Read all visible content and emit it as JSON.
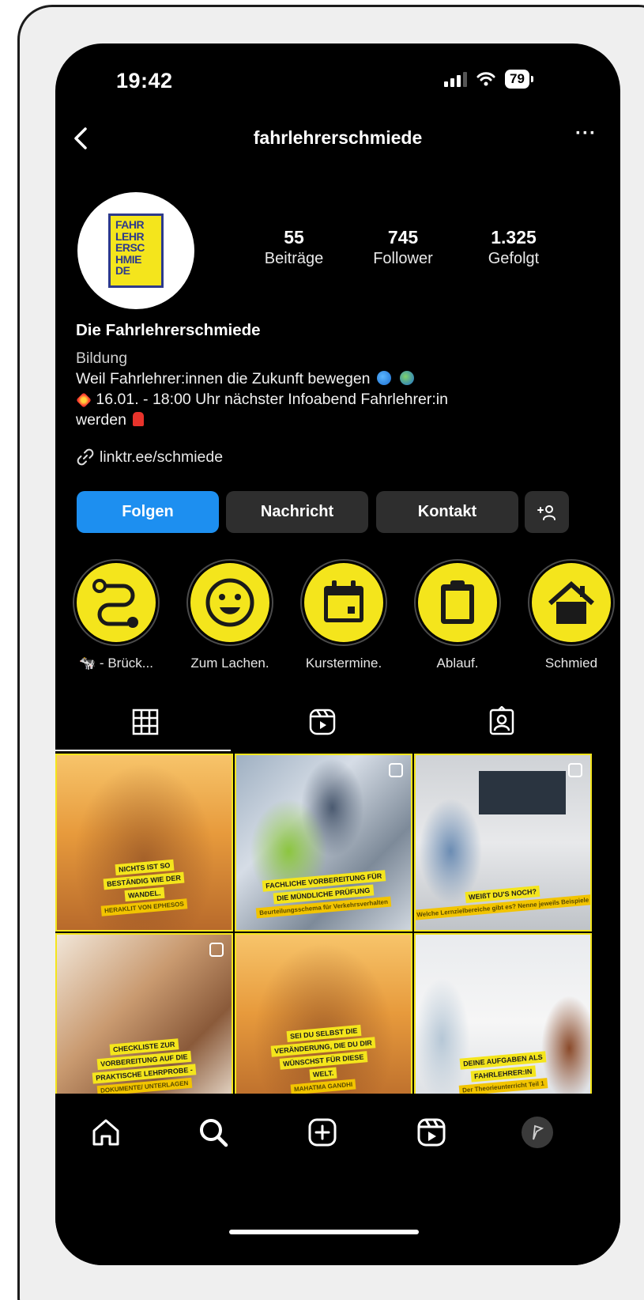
{
  "status_bar": {
    "time": "19:42",
    "battery": "79"
  },
  "header": {
    "username": "fahrlehrerschmiede",
    "more": "···"
  },
  "profile": {
    "logo_text": [
      "FAHR",
      "LEHR",
      "ERSC",
      "HMIE",
      "DE"
    ],
    "stats": [
      {
        "value": "55",
        "label": "Beiträge"
      },
      {
        "value": "745",
        "label": "Follower"
      },
      {
        "value": "1.325",
        "label": "Gefolgt"
      }
    ],
    "name": "Die Fahrlehrerschmiede",
    "category": "Bildung",
    "bio_line1": "Weil Fahrlehrer:innen die Zukunft bewegen",
    "bio_line2": "16.01. - 18:00 Uhr nächster Infoabend Fahrlehrer:in",
    "bio_line3": "werden",
    "link": "linktr.ee/schmiede"
  },
  "actions": {
    "follow": "Folgen",
    "message": "Nachricht",
    "contact": "Kontakt",
    "add_person": "+👤"
  },
  "highlights": [
    {
      "label": "🐄 - Brück...",
      "icon": "route-icon"
    },
    {
      "label": "Zum Lachen.",
      "icon": "smiley-icon"
    },
    {
      "label": "Kurstermine.",
      "icon": "calendar-icon"
    },
    {
      "label": "Ablauf.",
      "icon": "clipboard-icon"
    },
    {
      "label": "Schmied",
      "icon": "house-icon"
    }
  ],
  "tabs": [
    "grid-icon",
    "reels-icon",
    "tagged-icon"
  ],
  "posts": [
    {
      "lines": [
        "NICHTS IST SO",
        "BESTÄNDIG WIE DER",
        "WANDEL."
      ],
      "sub": "HERAKLIT VON EPHESOS",
      "bg": "sunset"
    },
    {
      "lines": [
        "FACHLICHE VORBEREITUNG FÜR",
        "DIE MÜNDLICHE PRÜFUNG"
      ],
      "sub": "Beurteilungsschema für Verkehrsverhalten",
      "bg": "office"
    },
    {
      "lines": [
        "WEIßT DU'S NOCH?"
      ],
      "sub": "Welche Lernzielbereiche gibt es? Nenne jeweils Beispiele",
      "bg": "meeting"
    },
    {
      "lines": [
        "CHECKLISTE ZUR",
        "VORBEREITUNG AUF DIE",
        "PRAKTISCHE LEHRPROBE -"
      ],
      "sub": "DOKUMENTE/ UNTERLAGEN",
      "bg": "fists"
    },
    {
      "lines": [
        "SEI DU SELBST DIE",
        "VERÄNDERUNG, DIE DU DIR",
        "WÜNSCHST FÜR DIESE",
        "WELT."
      ],
      "sub": "MAHATMA GANDHI",
      "bg": "sunset"
    },
    {
      "lines": [
        "DEINE AUFGABEN ALS",
        "FAHRLEHRER:IN"
      ],
      "sub": "Der Theorieunterricht Teil 1",
      "bg": "whiteboard"
    }
  ],
  "bottom_nav": [
    "home-icon",
    "search-icon",
    "create-icon",
    "reels-icon",
    "profile-icon"
  ]
}
